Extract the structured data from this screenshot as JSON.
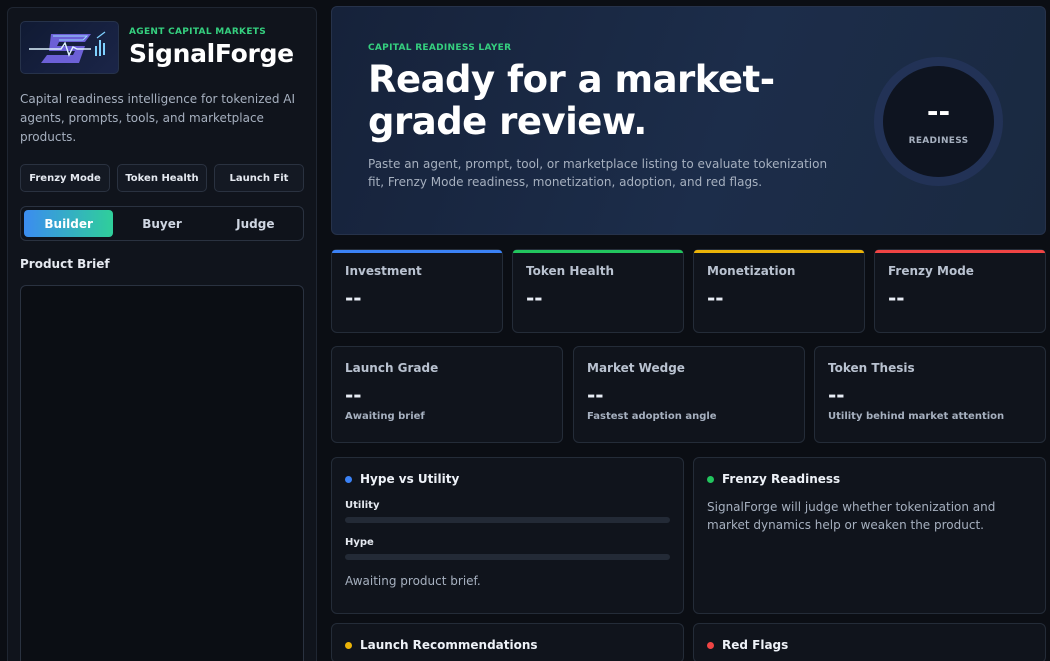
{
  "brand": {
    "kicker": "AGENT CAPITAL MARKETS",
    "name": "SignalForge",
    "tagline": "Capital readiness intelligence for tokenized AI agents, prompts, tools, and marketplace products."
  },
  "chips": [
    "Frenzy Mode",
    "Token Health",
    "Launch Fit"
  ],
  "modes": [
    "Builder",
    "Buyer",
    "Judge"
  ],
  "active_mode": "Builder",
  "brief": {
    "label": "Product Brief",
    "value": ""
  },
  "hero": {
    "kicker": "CAPITAL READINESS LAYER",
    "title": "Ready for a market-grade review.",
    "subtitle": "Paste an agent, prompt, tool, or marketplace listing to evaluate tokenization fit, Frenzy Mode readiness, monetization, adoption, and red flags.",
    "ring_value": "--",
    "ring_label": "READINESS"
  },
  "metrics": [
    {
      "title": "Investment",
      "value": "--",
      "accent": "#3b82f6"
    },
    {
      "title": "Token Health",
      "value": "--",
      "accent": "#22c55e"
    },
    {
      "title": "Monetization",
      "value": "--",
      "accent": "#eab308"
    },
    {
      "title": "Frenzy Mode",
      "value": "--",
      "accent": "#ef4444"
    }
  ],
  "grades": [
    {
      "title": "Launch Grade",
      "value": "--",
      "note": "Awaiting brief"
    },
    {
      "title": "Market Wedge",
      "value": "--",
      "note": "Fastest adoption angle"
    },
    {
      "title": "Token Thesis",
      "value": "--",
      "note": "Utility behind market attention"
    }
  ],
  "hype_utility": {
    "title": "Hype vs Utility",
    "dot_color": "#3b82f6",
    "utility_label": "Utility",
    "utility_level": 0,
    "hype_label": "Hype",
    "hype_level": 0,
    "status": "Awaiting product brief."
  },
  "frenzy": {
    "title": "Frenzy Readiness",
    "dot_color": "#22c55e",
    "text": "SignalForge will judge whether tokenization and market dynamics help or weaken the product."
  },
  "launch_recs": {
    "title": "Launch Recommendations",
    "dot_color": "#eab308"
  },
  "red_flags": {
    "title": "Red Flags",
    "dot_color": "#ef4444"
  }
}
